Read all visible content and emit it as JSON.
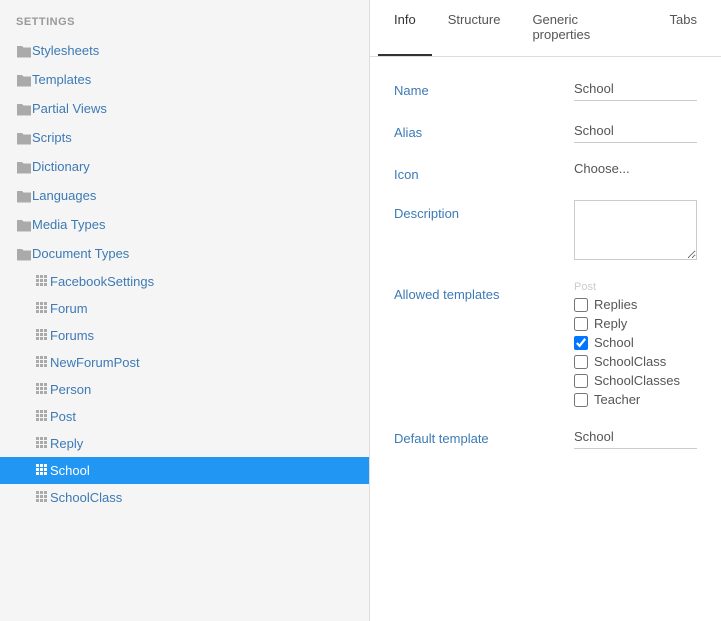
{
  "sidebar": {
    "section_label": "SETTINGS",
    "items": [
      {
        "id": "stylesheets",
        "label": "Stylesheets",
        "type": "folder",
        "active": false
      },
      {
        "id": "templates",
        "label": "Templates",
        "type": "folder",
        "active": false
      },
      {
        "id": "partial-views",
        "label": "Partial Views",
        "type": "folder",
        "active": false
      },
      {
        "id": "scripts",
        "label": "Scripts",
        "type": "folder",
        "active": false
      },
      {
        "id": "dictionary",
        "label": "Dictionary",
        "type": "folder",
        "active": false
      },
      {
        "id": "languages",
        "label": "Languages",
        "type": "folder",
        "active": false
      },
      {
        "id": "media-types",
        "label": "Media Types",
        "type": "folder",
        "active": false
      },
      {
        "id": "document-types",
        "label": "Document Types",
        "type": "folder",
        "active": false
      }
    ],
    "subitems": [
      {
        "id": "facebook-settings",
        "label": "FacebookSettings",
        "active": false
      },
      {
        "id": "forum",
        "label": "Forum",
        "active": false
      },
      {
        "id": "forums",
        "label": "Forums",
        "active": false
      },
      {
        "id": "new-forum-post",
        "label": "NewForumPost",
        "active": false
      },
      {
        "id": "person",
        "label": "Person",
        "active": false
      },
      {
        "id": "post",
        "label": "Post",
        "active": false
      },
      {
        "id": "reply",
        "label": "Reply",
        "active": false
      },
      {
        "id": "school",
        "label": "School",
        "active": true
      },
      {
        "id": "school-class",
        "label": "SchoolClass",
        "active": false
      }
    ]
  },
  "tabs": [
    {
      "id": "info",
      "label": "Info",
      "active": true
    },
    {
      "id": "structure",
      "label": "Structure",
      "active": false
    },
    {
      "id": "generic-properties",
      "label": "Generic properties",
      "active": false
    },
    {
      "id": "tabs",
      "label": "Tabs",
      "active": false
    }
  ],
  "form": {
    "name_label": "Name",
    "name_value": "School",
    "alias_label": "Alias",
    "alias_value": "School",
    "icon_label": "Icon",
    "icon_choose": "Choose...",
    "description_label": "Description",
    "description_value": "",
    "allowed_templates_label": "Allowed templates",
    "default_template_label": "Default template",
    "default_template_value": "School",
    "scrolled_hint": "Post",
    "templates": [
      {
        "id": "replies",
        "label": "Replies",
        "checked": false
      },
      {
        "id": "reply",
        "label": "Reply",
        "checked": false
      },
      {
        "id": "school",
        "label": "School",
        "checked": true
      },
      {
        "id": "school-class",
        "label": "SchoolClass",
        "checked": false
      },
      {
        "id": "school-classes",
        "label": "SchoolClasses",
        "checked": false
      },
      {
        "id": "teacher",
        "label": "Teacher",
        "checked": false
      }
    ]
  }
}
